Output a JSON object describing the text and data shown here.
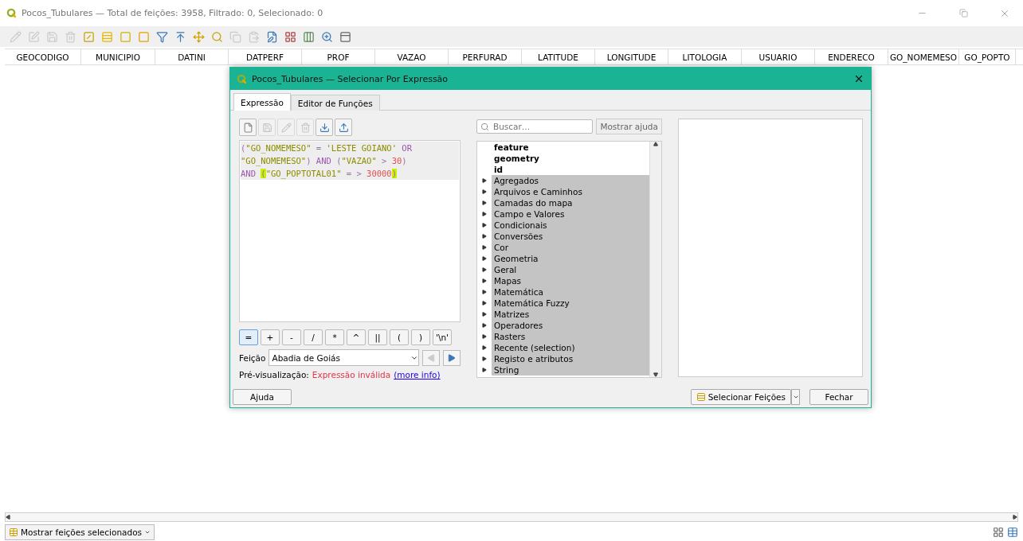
{
  "window": {
    "title": "Pocos_Tubulares — Total de feições: 3958, Filtrado: 0, Selecionado: 0"
  },
  "toolbar": [
    {
      "disabled": true
    },
    {
      "disabled": true
    },
    {
      "disabled": true
    },
    {
      "disabled": true
    },
    {
      "disabled": false
    },
    {
      "disabled": false
    },
    {
      "disabled": false
    },
    {
      "disabled": false
    },
    {
      "disabled": false
    },
    {
      "disabled": false
    },
    {
      "disabled": false
    },
    {
      "disabled": false
    },
    {
      "disabled": true
    },
    {
      "disabled": true
    },
    {
      "disabled": false
    },
    {
      "disabled": false
    },
    {
      "disabled": false
    },
    {
      "disabled": false
    },
    {
      "disabled": false
    }
  ],
  "table": {
    "columns": [
      "GEOCODIGO",
      "MUNICIPIO",
      "DATINI",
      "DATPERF",
      "PROF",
      "VAZAO",
      "PERFURAD",
      "LATITUDE",
      "LONGITUDE",
      "LITOLOGIA",
      "USUARIO",
      "ENDERECO",
      "GO_NOMEMESO",
      "GO_POPTO"
    ]
  },
  "dialog": {
    "title": "Pocos_Tubulares — Selecionar Por Expressão",
    "tabs": [
      {
        "label": "Expressão",
        "selected": true
      },
      {
        "label": "Editor de Funções",
        "selected": false
      }
    ],
    "editor_toolbar": [
      {
        "disabled": false
      },
      {
        "disabled": true
      },
      {
        "disabled": true
      },
      {
        "disabled": true
      },
      {
        "disabled": false
      },
      {
        "disabled": false
      }
    ],
    "expression_lines": [
      [
        {
          "kind": "operator",
          "text": "("
        },
        {
          "kind": "field",
          "text": "\"GO_NOMEMESO\""
        },
        {
          "kind": "operator",
          "text": " = "
        },
        {
          "kind": "string",
          "text": "'LESTE GOIANO'"
        },
        {
          "kind": "keyword",
          "text": " OR"
        }
      ],
      [
        {
          "kind": "field",
          "text": "\"GO_NOMEMESO\""
        },
        {
          "kind": "operator",
          "text": ")"
        },
        {
          "kind": "keyword",
          "text": " AND "
        },
        {
          "kind": "operator",
          "text": "("
        },
        {
          "kind": "field",
          "text": "\"VAZAO\""
        },
        {
          "kind": "operator",
          "text": " > "
        },
        {
          "kind": "number",
          "text": "30"
        },
        {
          "kind": "operator",
          "text": ")"
        }
      ],
      [
        {
          "kind": "keyword",
          "text": "AND "
        },
        {
          "kind": "bracket",
          "text": "("
        },
        {
          "kind": "field",
          "text": "\"GO_POPTOTAL01\""
        },
        {
          "kind": "operator",
          "text": " = > "
        },
        {
          "kind": "number",
          "text": "30000"
        },
        {
          "kind": "bracket",
          "text": ")"
        }
      ]
    ],
    "operators": [
      {
        "label": "=",
        "selected": true
      },
      {
        "label": "+",
        "selected": false
      },
      {
        "label": "-",
        "selected": false
      },
      {
        "label": "/",
        "selected": false
      },
      {
        "label": "*",
        "selected": false
      },
      {
        "label": "^",
        "selected": false
      },
      {
        "label": "||",
        "selected": false
      },
      {
        "label": "(",
        "selected": false
      },
      {
        "label": ")",
        "selected": false
      },
      {
        "label": "'\\n'",
        "selected": false
      }
    ],
    "feature": {
      "label": "Feição",
      "value": "Abadia de Goiás",
      "prev_disabled": true
    },
    "preview": {
      "label": "Pré-visualização:",
      "value": "Expressão inválida",
      "link": "(more info)"
    },
    "search": {
      "placeholder": "Buscar…"
    },
    "help_toggle": "Mostrar ajuda",
    "functions": [
      {
        "kind": "variable",
        "label": "feature"
      },
      {
        "kind": "variable",
        "label": "geometry"
      },
      {
        "kind": "variable",
        "label": "id"
      },
      {
        "kind": "group",
        "label": "Agregados"
      },
      {
        "kind": "group",
        "label": "Arquivos e Caminhos"
      },
      {
        "kind": "group",
        "label": "Camadas do mapa"
      },
      {
        "kind": "group",
        "label": "Campo e Valores"
      },
      {
        "kind": "group",
        "label": "Condicionais"
      },
      {
        "kind": "group",
        "label": "Conversões"
      },
      {
        "kind": "group",
        "label": "Cor"
      },
      {
        "kind": "group",
        "label": "Geometria"
      },
      {
        "kind": "group",
        "label": "Geral"
      },
      {
        "kind": "group",
        "label": "Mapas"
      },
      {
        "kind": "group",
        "label": "Matemática"
      },
      {
        "kind": "group",
        "label": "Matemática Fuzzy"
      },
      {
        "kind": "group",
        "label": "Matrizes"
      },
      {
        "kind": "group",
        "label": "Operadores"
      },
      {
        "kind": "group",
        "label": "Rasters"
      },
      {
        "kind": "group",
        "label": "Recente (selection)"
      },
      {
        "kind": "group",
        "label": "Registo e atributos"
      },
      {
        "kind": "group",
        "label": "String"
      }
    ],
    "buttons": {
      "help": "Ajuda",
      "select": "Selecionar Feições",
      "close": "Fechar"
    }
  },
  "status_bar": {
    "filter_button": "Mostrar feições selecionados"
  }
}
